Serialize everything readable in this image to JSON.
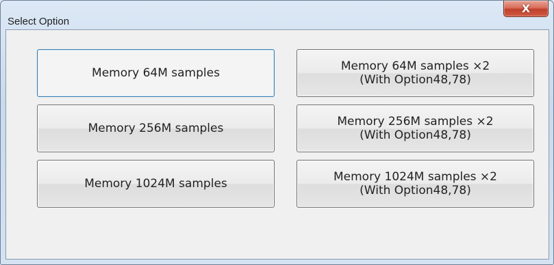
{
  "window": {
    "title": "Select Option",
    "close_label": "X"
  },
  "options": {
    "left": [
      {
        "label": "Memory 64M samples"
      },
      {
        "label": "Memory 256M samples"
      },
      {
        "label": "Memory 1024M samples"
      }
    ],
    "right": [
      {
        "line1": "Memory 64M samples ×2",
        "line2": "(With Option48,78)"
      },
      {
        "line1": "Memory 256M samples ×2",
        "line2": "(With Option48,78)"
      },
      {
        "line1": "Memory 1024M samples ×2",
        "line2": "(With Option48,78)"
      }
    ]
  },
  "colors": {
    "close_button": "#c7432f",
    "client_background": "#f0f0f0",
    "focus_border": "#3c7fb1"
  }
}
